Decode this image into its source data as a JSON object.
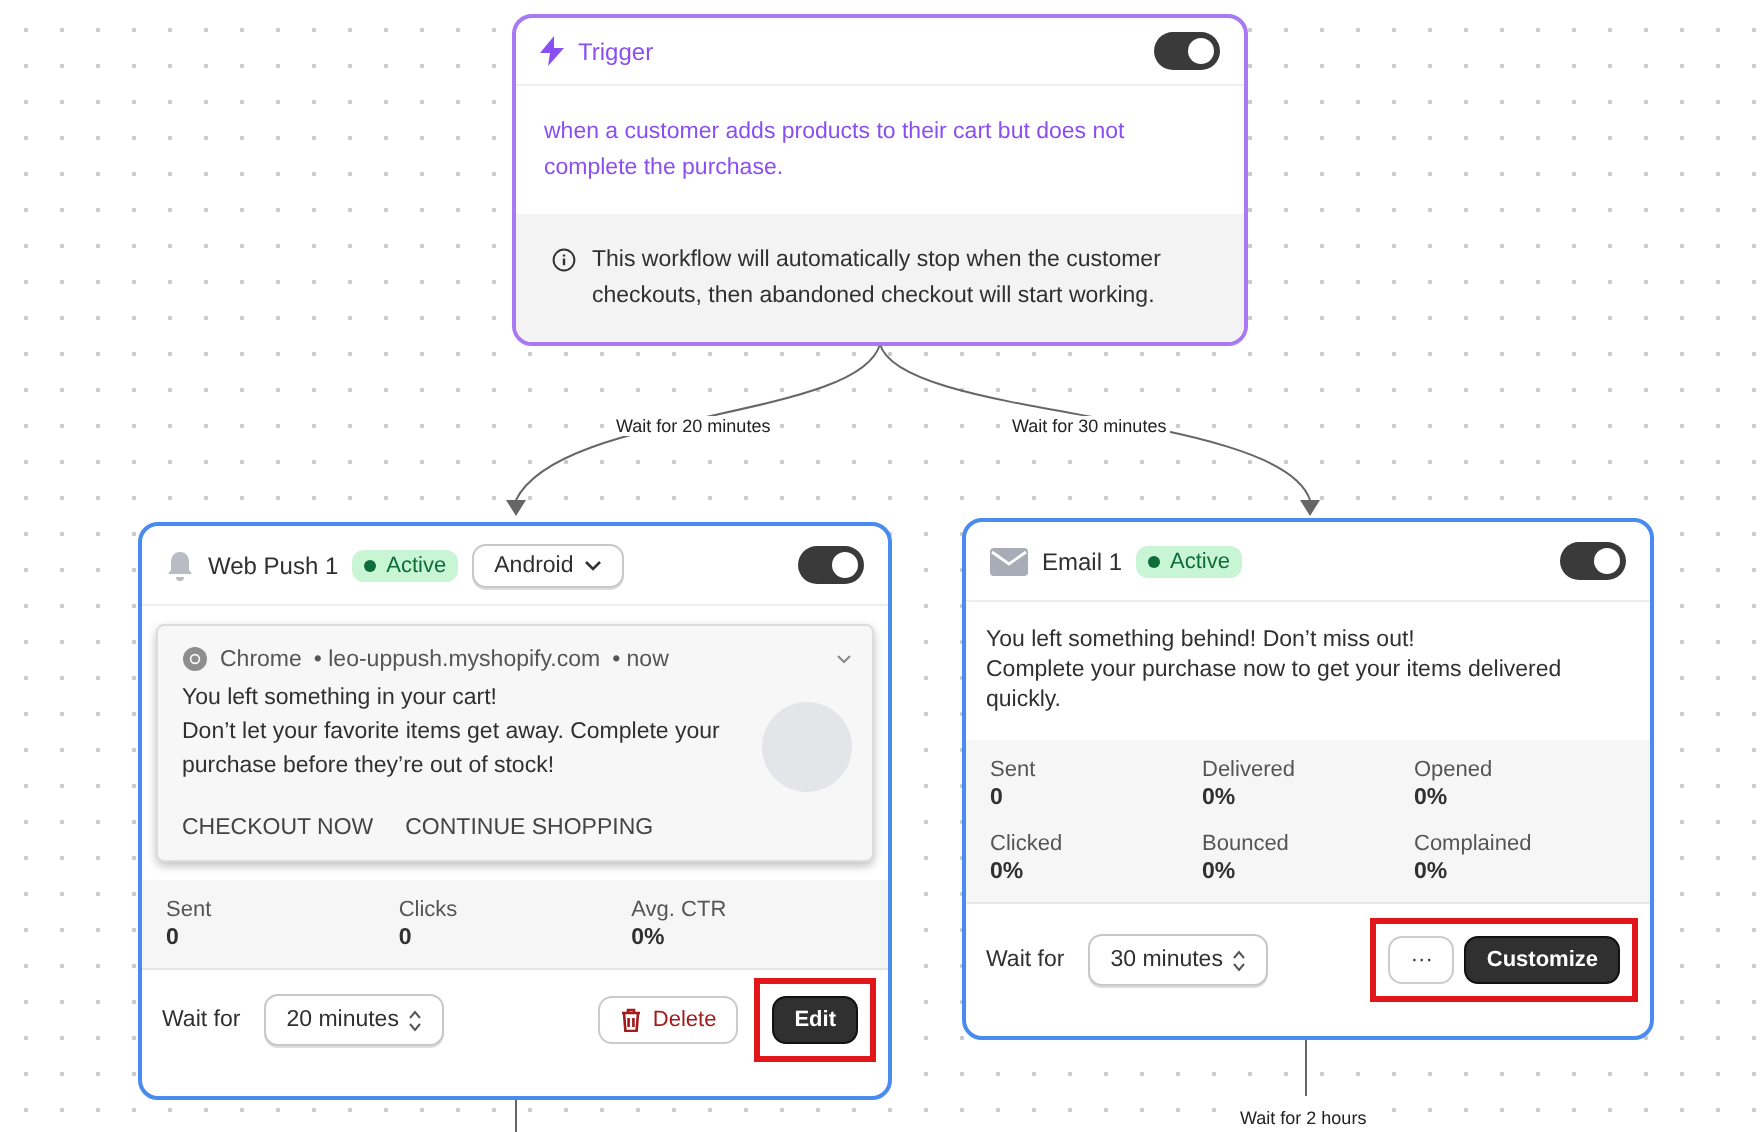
{
  "trigger": {
    "title": "Trigger",
    "enabled": true,
    "description": "when a customer adds products to their cart but does not complete the purchase.",
    "note": "This workflow will automatically stop when the customer checkouts, then abandoned checkout will start working."
  },
  "edges": [
    {
      "label": "Wait for 20 minutes"
    },
    {
      "label": "Wait for 30 minutes"
    },
    {
      "label": "Wait for 2 hours"
    }
  ],
  "nodes": [
    {
      "kind": "webpush",
      "title": "Web Push 1",
      "status": "Active",
      "enabled": true,
      "platform": "Android",
      "preview": {
        "browser": "Chrome",
        "site": "• leo-uppush.myshopify.com",
        "time": "• now",
        "heading": "You left something in your cart!",
        "body": "Don’t let your favorite items get away. Complete your purchase before they’re out of stock!",
        "actions": [
          "CHECKOUT NOW",
          "CONTINUE SHOPPING"
        ]
      },
      "stats": [
        {
          "label": "Sent",
          "value": "0"
        },
        {
          "label": "Clicks",
          "value": "0"
        },
        {
          "label": "Avg. CTR",
          "value": "0%"
        }
      ],
      "wait_label": "Wait for",
      "wait": "20 minutes",
      "buttons": [
        {
          "kind": "delete",
          "label": "Delete",
          "highlighted": false
        },
        {
          "kind": "primary",
          "label": "Edit",
          "highlighted": true
        }
      ]
    },
    {
      "kind": "email",
      "title": "Email 1",
      "status": "Active",
      "enabled": true,
      "message": [
        "You left something behind! Don’t miss out!",
        "Complete your purchase now to get your items delivered quickly."
      ],
      "stats": [
        {
          "label": "Sent",
          "value": "0"
        },
        {
          "label": "Delivered",
          "value": "0%"
        },
        {
          "label": "Opened",
          "value": "0%"
        },
        {
          "label": "Clicked",
          "value": "0%"
        },
        {
          "label": "Bounced",
          "value": "0%"
        },
        {
          "label": "Complained",
          "value": "0%"
        }
      ],
      "wait_label": "Wait for",
      "wait": "30 minutes",
      "buttons": [
        {
          "kind": "more",
          "label": "···",
          "highlighted": true
        },
        {
          "kind": "primary",
          "label": "Customize",
          "highlighted": true
        }
      ]
    }
  ]
}
